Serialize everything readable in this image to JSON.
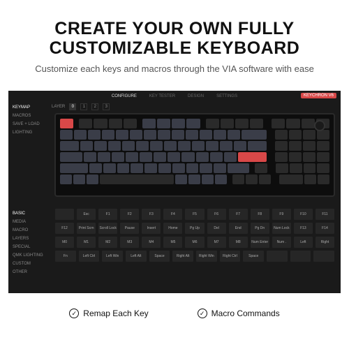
{
  "hero": {
    "title_l1": "CREATE YOUR OWN FULLY",
    "title_l2": "CUSTOMIZABLE KEYBOARD",
    "subtitle": "Customize each keys and macros through the VIA software with ease"
  },
  "app": {
    "topnav": [
      "CONFIGURE",
      "KEY TESTER",
      "DESIGN",
      "SETTINGS"
    ],
    "badge": "KEYCHRON V6",
    "side_upper": [
      "KEYMAP",
      "MACROS",
      "SAVE + LOAD",
      "LIGHTING"
    ],
    "side_lower": [
      "BASIC",
      "MEDIA",
      "MACRO",
      "LAYERS",
      "SPECIAL",
      "QMK LIGHTING",
      "CUSTOM",
      "OTHER"
    ],
    "layer_label": "LAYER",
    "layers": [
      "0",
      "1",
      "2",
      "3"
    ],
    "palette_rows": [
      [
        "",
        "Esc",
        "F1",
        "F2",
        "F3",
        "F4",
        "F5",
        "F6",
        "F7",
        "F8",
        "F9",
        "F10",
        "F11"
      ],
      [
        "F12",
        "Print Scrn",
        "Scroll Lock",
        "Pause",
        "Insert",
        "Home",
        "Pg Up",
        "Del",
        "End",
        "Pg Dn",
        "Num Lock",
        "F13",
        "F14"
      ],
      [
        "M0",
        "M1",
        "M2",
        "M3",
        "M4",
        "M5",
        "M6",
        "M7",
        "M8",
        "Num Enter",
        "Num .",
        "Left",
        "Right"
      ],
      [
        "Fn",
        "Left Ctrl",
        "Left Win",
        "Left Alt",
        "Space",
        "Right Alt",
        "Right Win",
        "Right Ctrl",
        "Space",
        "",
        "",
        ""
      ]
    ]
  },
  "features": {
    "f1": "Remap Each Key",
    "f2": "Macro Commands"
  }
}
